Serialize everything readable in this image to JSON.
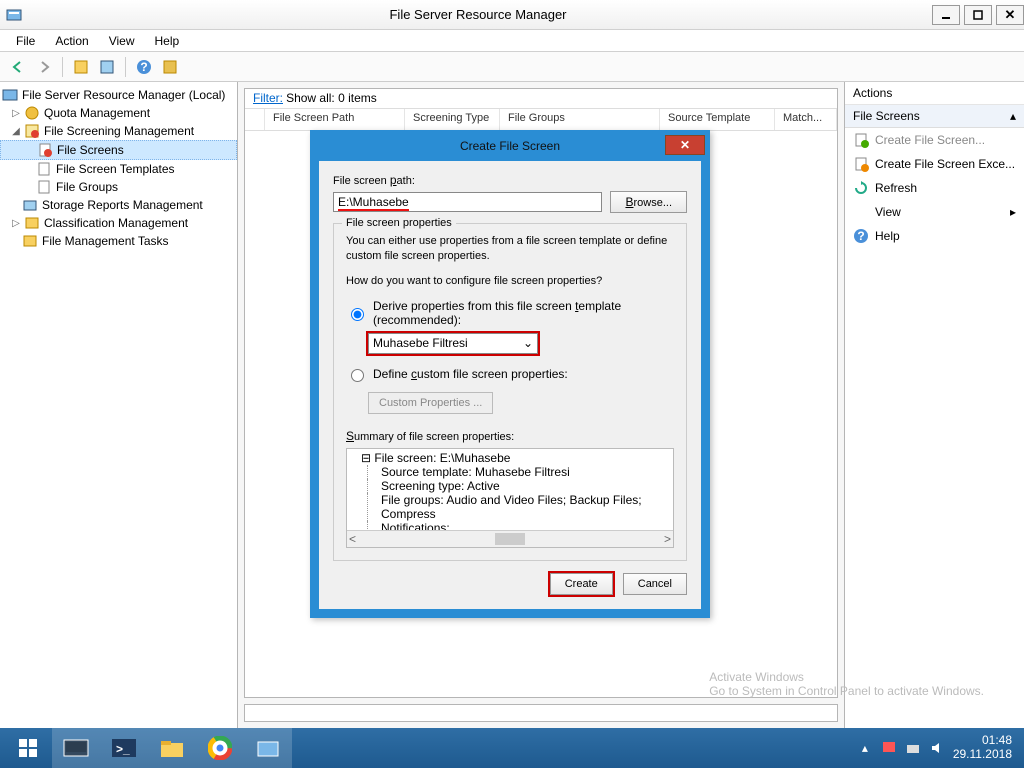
{
  "window": {
    "title": "File Server Resource Manager"
  },
  "menubar": [
    "File",
    "Action",
    "View",
    "Help"
  ],
  "tree": {
    "root": "File Server Resource Manager (Local)",
    "items": [
      {
        "label": "Quota Management",
        "depth": 1,
        "exp": "▷"
      },
      {
        "label": "File Screening Management",
        "depth": 1,
        "exp": "◢"
      },
      {
        "label": "File Screens",
        "depth": 2,
        "sel": true
      },
      {
        "label": "File Screen Templates",
        "depth": 2
      },
      {
        "label": "File Groups",
        "depth": 2
      },
      {
        "label": "Storage Reports Management",
        "depth": 1
      },
      {
        "label": "Classification Management",
        "depth": 1,
        "exp": "▷"
      },
      {
        "label": "File Management Tasks",
        "depth": 1
      }
    ]
  },
  "filter": {
    "label": "Filter:",
    "text": "Show all: 0 items"
  },
  "columns": [
    "File Screen Path",
    "Screening Type",
    "File Groups",
    "Source Template",
    "Match..."
  ],
  "actions": {
    "header": "Actions",
    "section": "File Screens",
    "items": [
      {
        "label": "Create File Screen...",
        "icon": "create"
      },
      {
        "label": "Create File Screen Exce...",
        "icon": "create2"
      },
      {
        "label": "Refresh",
        "icon": "refresh"
      },
      {
        "label": "View",
        "icon": "",
        "arrow": true
      },
      {
        "label": "Help",
        "icon": "help"
      }
    ]
  },
  "dialog": {
    "title": "Create File Screen",
    "path_label": "File screen path:",
    "path": "E:\\Muhasebe",
    "browse": "Browse...",
    "fieldset_legend": "File screen properties",
    "desc": "You can either use properties from a file screen template or define custom file screen properties.",
    "question": "How do you want to configure file screen properties?",
    "radio1": "Derive properties from this file screen template (recommended):",
    "template": "Muhasebe Filtresi",
    "radio2": "Define custom file screen properties:",
    "custom_btn": "Custom Properties ...",
    "summary_label": "Summary of file screen properties:",
    "summary": {
      "root": "File screen: E:\\Muhasebe",
      "lines": [
        "Source template: Muhasebe Filtresi",
        "Screening type: Active",
        "File groups: Audio and Video Files; Backup Files; Compress",
        "Notifications:"
      ]
    },
    "create": "Create",
    "cancel": "Cancel"
  },
  "watermark": {
    "t1": "Activate Windows",
    "t2": "Go to System in Control Panel to activate Windows."
  },
  "taskbar": {
    "time": "01:48",
    "date": "29.11.2018",
    "tray_caret": "▴"
  }
}
